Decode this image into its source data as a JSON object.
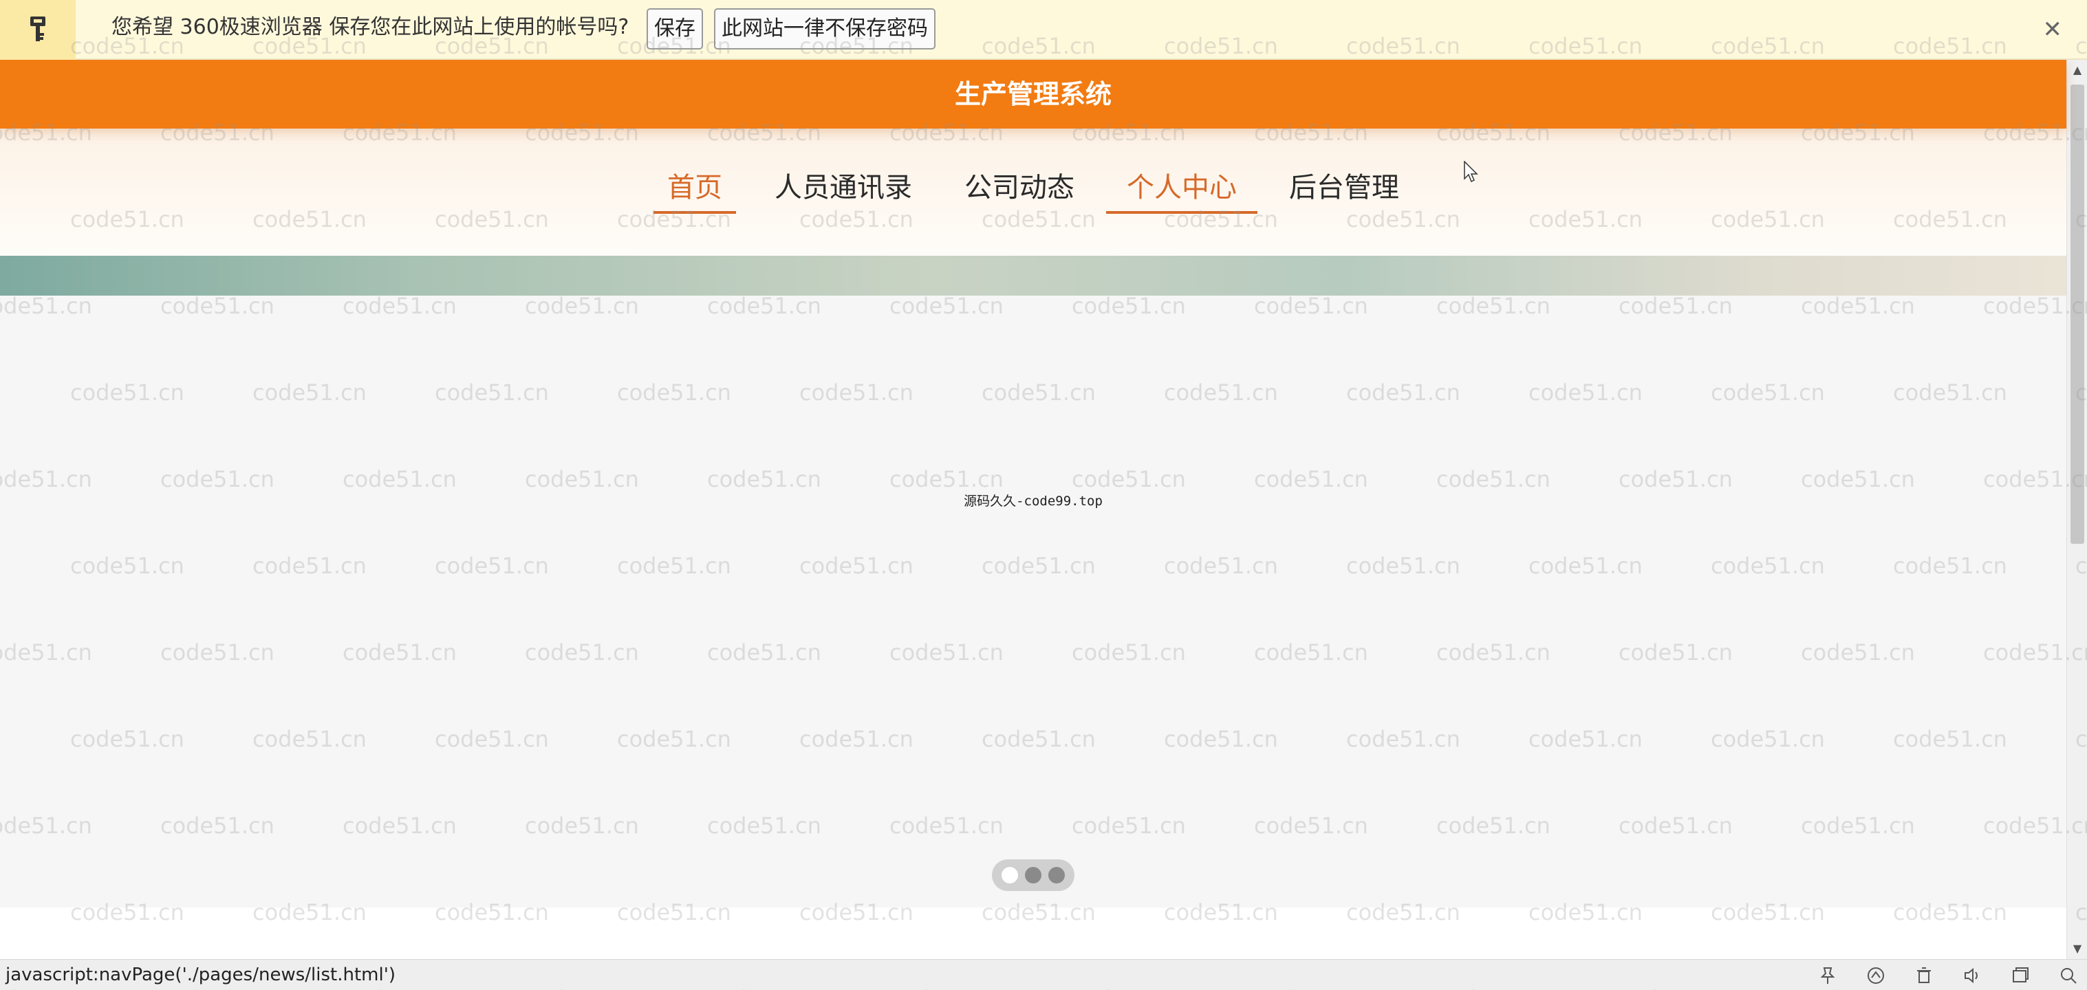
{
  "password_bar": {
    "prompt": "您希望 360极速浏览器 保存您在此网站上使用的帐号吗?",
    "save_label": "保存",
    "never_label": "此网站一律不保存密码",
    "close_label": "✕"
  },
  "header": {
    "title": "生产管理系统"
  },
  "nav": {
    "items": [
      {
        "label": "首页"
      },
      {
        "label": "人员通讯录"
      },
      {
        "label": "公司动态"
      },
      {
        "label": "个人中心"
      },
      {
        "label": "后台管理"
      }
    ]
  },
  "main": {
    "center_text": "源码久久-code99.top"
  },
  "carousel": {
    "dot_count": 3,
    "active_index": 0
  },
  "status_bar": {
    "url": "javascript:navPage('./pages/news/list.html')",
    "icons": [
      "pin-icon",
      "speed-icon",
      "trash-icon",
      "speaker-icon",
      "window-icon",
      "zoom-icon"
    ]
  },
  "watermark": {
    "text": "code51.cn"
  },
  "colors": {
    "brand_orange": "#f27b12",
    "nav_active": "#d66a2a",
    "password_bar_bg": "#fff9dc"
  }
}
